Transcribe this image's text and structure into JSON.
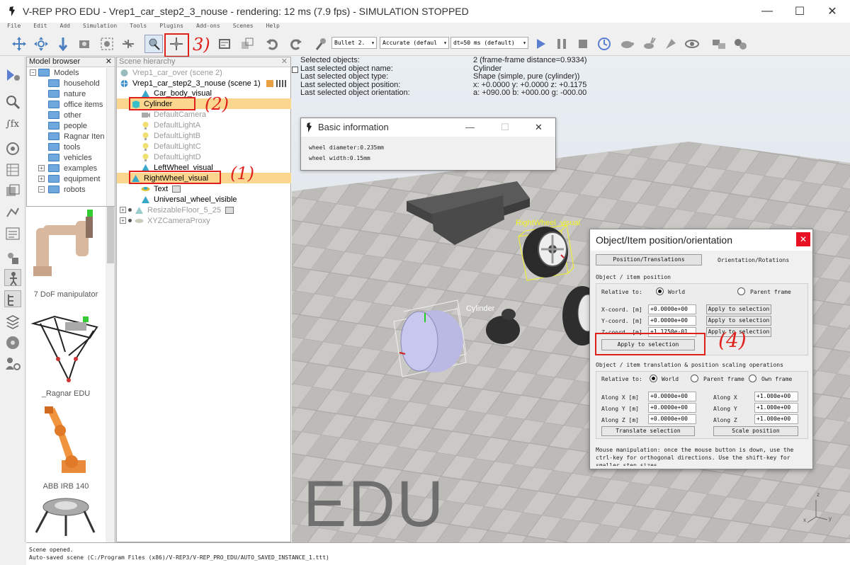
{
  "window": {
    "title": "V-REP PRO EDU - Vrep1_car_step2_3_nouse - rendering: 12 ms (7.9 fps) - SIMULATION STOPPED",
    "minimize": "—",
    "maximize": "☐",
    "close": "✕"
  },
  "menu": [
    "File",
    "Edit",
    "Add",
    "Simulation",
    "Tools",
    "Plugins",
    "Add-ons",
    "Scenes",
    "Help"
  ],
  "toolbar": {
    "engine": "Bullet 2.",
    "accuracy": "Accurate (defaul",
    "timestep": "dt=50 ms (default)"
  },
  "model_browser": {
    "title": "Model browser",
    "close": "✕",
    "items": [
      {
        "label": "Models",
        "expanded": true
      },
      {
        "label": "household"
      },
      {
        "label": "nature"
      },
      {
        "label": "office items"
      },
      {
        "label": "other"
      },
      {
        "label": "people"
      },
      {
        "label": "Ragnar Iten"
      },
      {
        "label": "tools"
      },
      {
        "label": "vehicles"
      },
      {
        "label": "examples",
        "collapsed": true
      },
      {
        "label": "equipment",
        "collapsed": true
      },
      {
        "label": "robots",
        "expanded": true
      }
    ],
    "thumbnails": [
      "7 DoF manipulator",
      "_Ragnar EDU",
      "ABB IRB 140"
    ]
  },
  "scene_hierarchy": {
    "title": "Scene hierarchy",
    "close": "✕",
    "rows": [
      {
        "label": "Vrep1_car_over (scene 2)",
        "dim": true
      },
      {
        "label": "Vrep1_car_step2_3_nouse (scene 1)",
        "dim": false
      },
      {
        "label": "Car_body_visual",
        "dim": false
      },
      {
        "label": "Cylinder",
        "dim": false,
        "highlight": true
      },
      {
        "label": "DefaultCamera",
        "dim": true
      },
      {
        "label": "DefaultLightA",
        "dim": true
      },
      {
        "label": "DefaultLightB",
        "dim": true
      },
      {
        "label": "DefaultLightC",
        "dim": true
      },
      {
        "label": "DefaultLightD",
        "dim": true
      },
      {
        "label": "LeftWheel_visual",
        "dim": false
      },
      {
        "label": "RightWheel_visual",
        "dim": false,
        "highlight": true
      },
      {
        "label": "Text",
        "dim": false
      },
      {
        "label": "Universal_wheel_visible",
        "dim": false
      },
      {
        "label": "ResizableFloor_5_25",
        "dim": true
      },
      {
        "label": "XYZCameraProxy",
        "dim": true
      }
    ]
  },
  "selection_info": {
    "rows": [
      {
        "label": "Selected objects:",
        "value": "2 (frame-frame distance=0.9334)"
      },
      {
        "label": "Last selected object name:",
        "value": "Cylinder"
      },
      {
        "label": "Last selected object type:",
        "value": "Shape (simple, pure (cylinder))"
      },
      {
        "label": "Last selected object position:",
        "value": "x: +0.0000   y: +0.0000   z: +0.1175"
      },
      {
        "label": "Last selected object orientation:",
        "value": "a: +090.00   b: +000.00   g: -000.00"
      }
    ]
  },
  "basic_info": {
    "title": "Basic information",
    "lines": [
      "wheel diameter:0.235mm",
      "wheel width:0.15mm"
    ]
  },
  "scene_labels": {
    "right_wheel": "RightWheel_visual",
    "cylinder": "Cylinder",
    "watermark": "EDU"
  },
  "pos_dialog": {
    "title": "Object/Item position/orientation",
    "tab_position": "Position/Translations",
    "tab_orientation": "Orientation/Rotations",
    "section1": "Object / item position",
    "relative_to": "Relative to:",
    "world": "World",
    "parent_frame": "Parent frame",
    "own_frame": "Own frame",
    "x_coord": "X-coord. [m]",
    "y_coord": "Y-coord. [m]",
    "z_coord": "Z-coord. [m]",
    "x_val": "+0.0000e+00",
    "y_val": "+0.0000e+00",
    "z_val": "+1.1750e-01",
    "apply_row": "Apply to selection",
    "apply_all": "Apply to selection",
    "section2": "Object / item translation & position scaling operations",
    "along_x_m": "Along X [m]",
    "along_y_m": "Along Y [m]",
    "along_z_m": "Along Z [m]",
    "tx": "+0.0000e+00",
    "ty": "+0.0000e+00",
    "tz": "+0.0000e+00",
    "along_x": "Along X",
    "along_y": "Along Y",
    "along_z": "Along Z",
    "sx": "+1.000e+00",
    "sy": "+1.000e+00",
    "sz": "+1.000e+00",
    "translate": "Translate selection",
    "scale": "Scale position",
    "footer": "Mouse manipulation: once the mouse button is down, use the ctrl-key for orthogonal directions. Use the shift-key for smaller step sizes."
  },
  "status": {
    "line1": "Scene opened.",
    "line2": "Auto-saved scene (C:/Program Files (x86)/V-REP3/V-REP_PRO_EDU/AUTO_SAVED_INSTANCE_1.ttt)"
  },
  "annotations": [
    "1",
    "2",
    "3",
    "4"
  ],
  "colors": {
    "highlight": "#fbd68e",
    "annotation": "#e0201c",
    "folder": "#6fa8dc",
    "close_red": "#e81123"
  }
}
